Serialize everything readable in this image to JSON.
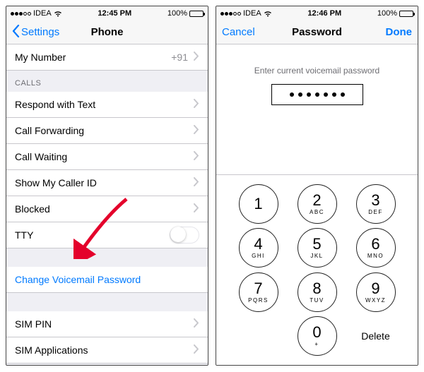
{
  "left": {
    "status": {
      "carrier": "IDEA",
      "time": "12:45 PM",
      "battery": "100%"
    },
    "nav": {
      "back": "Settings",
      "title": "Phone"
    },
    "my_number_label": "My Number",
    "my_number_value": "+91",
    "section_calls": "CALLS",
    "rows": {
      "respond": "Respond with Text",
      "forwarding": "Call Forwarding",
      "waiting": "Call Waiting",
      "callerid": "Show My Caller ID",
      "blocked": "Blocked",
      "tty": "TTY",
      "change_vm": "Change Voicemail Password",
      "sim_pin": "SIM PIN",
      "sim_apps": "SIM Applications"
    }
  },
  "right": {
    "status": {
      "carrier": "IDEA",
      "time": "12:46 PM",
      "battery": "100%"
    },
    "nav": {
      "cancel": "Cancel",
      "title": "Password",
      "done": "Done"
    },
    "prompt": "Enter current voicemail password",
    "password_dots": 7,
    "keys": [
      {
        "n": "1",
        "l": ""
      },
      {
        "n": "2",
        "l": "ABC"
      },
      {
        "n": "3",
        "l": "DEF"
      },
      {
        "n": "4",
        "l": "GHI"
      },
      {
        "n": "5",
        "l": "JKL"
      },
      {
        "n": "6",
        "l": "MNO"
      },
      {
        "n": "7",
        "l": "PQRS"
      },
      {
        "n": "8",
        "l": "TUV"
      },
      {
        "n": "9",
        "l": "WXYZ"
      },
      {
        "n": "0",
        "l": "+"
      }
    ],
    "delete": "Delete"
  },
  "colors": {
    "tint": "#007aff"
  }
}
